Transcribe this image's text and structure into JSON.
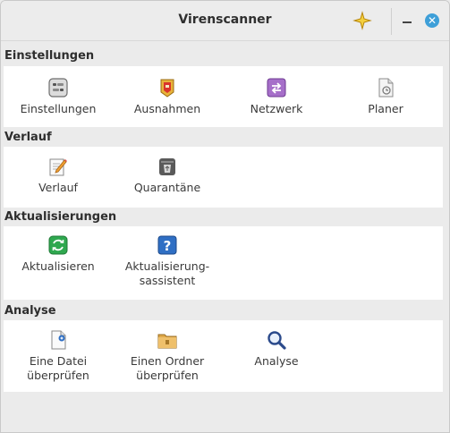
{
  "window": {
    "title": "Virenscanner"
  },
  "titlebar": {
    "close_glyph": "✕"
  },
  "sections": [
    {
      "title": "Einstellungen",
      "items": [
        {
          "label": "Einstellungen",
          "icon": "settings-icon"
        },
        {
          "label": "Ausnahmen",
          "icon": "exceptions-icon"
        },
        {
          "label": "Netzwerk",
          "icon": "network-icon"
        },
        {
          "label": "Planer",
          "icon": "scheduler-icon"
        }
      ]
    },
    {
      "title": "Verlauf",
      "items": [
        {
          "label": "Verlauf",
          "icon": "history-icon"
        },
        {
          "label": "Quarantäne",
          "icon": "quarantine-icon"
        }
      ]
    },
    {
      "title": "Aktualisierungen",
      "items": [
        {
          "label": "Aktualisieren",
          "icon": "update-icon"
        },
        {
          "label": "Aktualisierung-\nsassistent",
          "icon": "help-icon"
        }
      ]
    },
    {
      "title": "Analyse",
      "items": [
        {
          "label": "Eine Datei\nüberprüfen",
          "icon": "scan-file-icon"
        },
        {
          "label": "Einen Ordner\nüberprüfen",
          "icon": "scan-folder-icon"
        },
        {
          "label": "Analyse",
          "icon": "analyse-icon"
        }
      ]
    }
  ]
}
